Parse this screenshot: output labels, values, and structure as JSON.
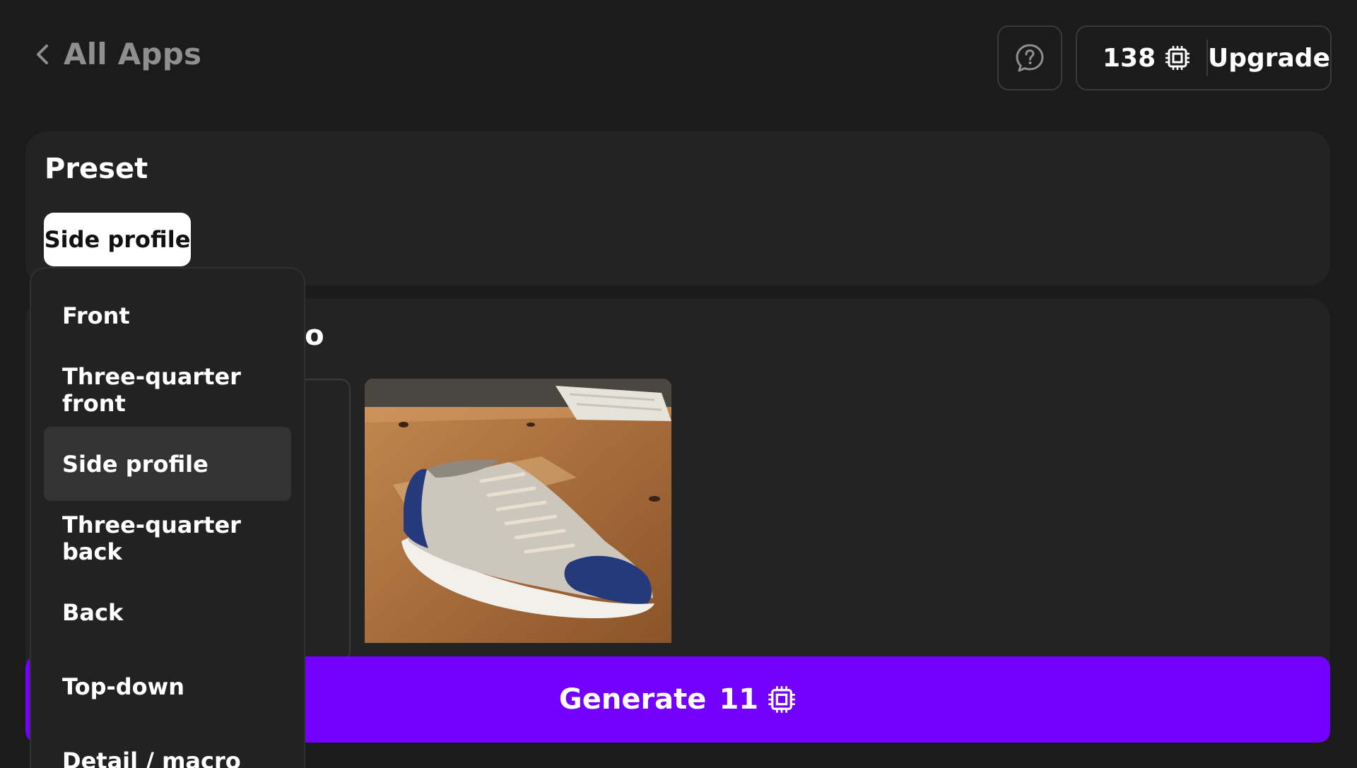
{
  "header": {
    "back_label": "All Apps",
    "credits": "138",
    "upgrade_label": "Upgrade"
  },
  "preset": {
    "title": "Preset",
    "selected": "Side profile",
    "options": [
      "Front",
      "Three-quarter front",
      "Side profile",
      "Three-quarter back",
      "Back",
      "Top-down",
      "Detail / macro"
    ]
  },
  "photo": {
    "title_visible_fragment": "to"
  },
  "generate": {
    "label": "Generate",
    "cost": "11"
  },
  "colors": {
    "background": "#1b1b1b",
    "panel": "#232323",
    "accent": "#7300ff"
  }
}
